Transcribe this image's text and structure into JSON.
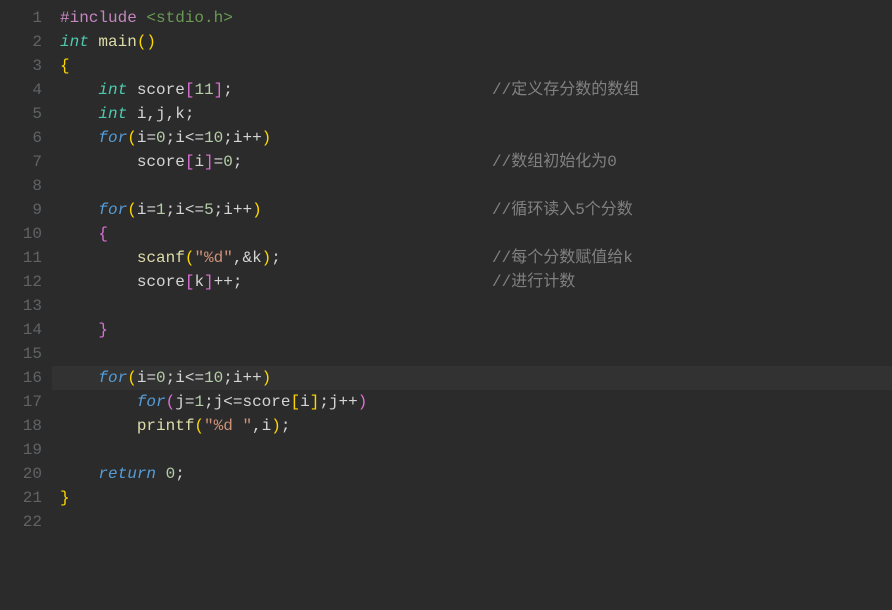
{
  "chart_data": null,
  "lineNumbers": [
    "1",
    "2",
    "3",
    "4",
    "5",
    "6",
    "7",
    "8",
    "9",
    "10",
    "11",
    "12",
    "13",
    "14",
    "15",
    "16",
    "17",
    "18",
    "19",
    "20",
    "21",
    "22"
  ],
  "highlightedLine": 16,
  "code": {
    "l1": {
      "preproc": "#include",
      "path": " <stdio.h>"
    },
    "l2": {
      "type": "int",
      "func": "main",
      "paren": "()"
    },
    "l3": {
      "brace": "{"
    },
    "l4": {
      "type": "int",
      "ident": " score",
      "bracket_open": "[",
      "num": "11",
      "bracket_close": "]",
      "semi": ";",
      "comment": "//定义存分数的数组"
    },
    "l5": {
      "type": "int",
      "ident": " i,j,k;",
      "punct": ";"
    },
    "l6": {
      "kw": "for",
      "open": "(",
      "p1": "i",
      "op1": "=",
      "n1": "0",
      "p2": ";i",
      "op2": "<=",
      "n2": "10",
      "p3": ";i",
      "op3": "++",
      "close": ")"
    },
    "l7": {
      "ident": "score",
      "bopen": "[",
      "inner": "i",
      "bclose": "]",
      "op": "=",
      "num": "0",
      "semi": ";",
      "comment": "//数组初始化为0"
    },
    "l9": {
      "kw": "for",
      "open": "(",
      "p1": "i",
      "op1": "=",
      "n1": "1",
      "p2": ";i",
      "op2": "<=",
      "n2": "5",
      "p3": ";i",
      "op3": "++",
      "close": ")",
      "comment": "//循环读入5个分数"
    },
    "l10": {
      "brace": "{"
    },
    "l11": {
      "func": "scanf",
      "open": "(",
      "str": "\"%d\"",
      "comma": ",",
      "amp": "&",
      "var": "k",
      "close": ")",
      "semi": ";",
      "comment": "//每个分数赋值给k"
    },
    "l12": {
      "ident": "score",
      "bopen": "[",
      "inner": "k",
      "bclose": "]",
      "op": "++",
      "semi": ";",
      "comment": "//进行计数"
    },
    "l14": {
      "brace": "}"
    },
    "l16": {
      "kw": "for",
      "open": "(",
      "p1": "i",
      "op1": "=",
      "n1": "0",
      "p2": ";i",
      "op2": "<=",
      "n2": "10",
      "p3": ";i",
      "op3": "++",
      "close": ")"
    },
    "l17": {
      "kw": "for",
      "open": "(",
      "p1": "j",
      "op1": "=",
      "n1": "1",
      "p2": ";j",
      "op2": "<=",
      "call": "score",
      "bopen": "[",
      "inner": "i",
      "bclose": "]",
      "p3": ";j",
      "op3": "++",
      "close": ")"
    },
    "l18": {
      "func": "printf",
      "open": "(",
      "str": "\"%d \"",
      "comma": ",",
      "var": "i",
      "close": ")",
      "semi": ";"
    },
    "l20": {
      "kw": "return",
      "sp": " ",
      "num": "0",
      "semi": ";"
    },
    "l21": {
      "brace": "}"
    }
  }
}
